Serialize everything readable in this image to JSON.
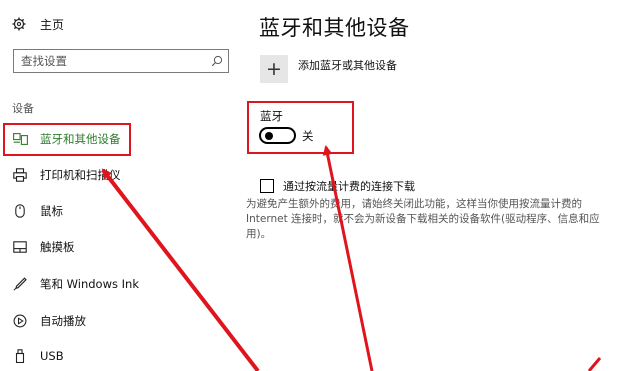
{
  "sidebar": {
    "home_label": "主页",
    "search_placeholder": "查找设置",
    "section_title": "设备",
    "items": [
      {
        "label": "蓝牙和其他设备",
        "icon": "bluetooth-devices-icon",
        "active": true
      },
      {
        "label": "打印机和扫描仪",
        "icon": "printer-icon",
        "active": false
      },
      {
        "label": "鼠标",
        "icon": "mouse-icon",
        "active": false
      },
      {
        "label": "触摸板",
        "icon": "touchpad-icon",
        "active": false
      },
      {
        "label": "笔和 Windows Ink",
        "icon": "pen-icon",
        "active": false
      },
      {
        "label": "自动播放",
        "icon": "autoplay-icon",
        "active": false
      },
      {
        "label": "USB",
        "icon": "usb-icon",
        "active": false
      }
    ]
  },
  "main": {
    "title": "蓝牙和其他设备",
    "add_device_label": "添加蓝牙或其他设备",
    "bluetooth_label": "蓝牙",
    "bluetooth_state": "关",
    "bluetooth_on": false,
    "metered_label": "通过按流量计费的连接下载",
    "metered_checked": false,
    "metered_description": "为避免产生额外的费用，请始终关闭此功能，这样当你使用按流量计费的 Internet 连接时，就不会为新设备下载相关的设备软件(驱动程序、信息和应用)。"
  },
  "colors": {
    "accent_active": "#2d7d2d",
    "highlight_red": "#e0141c"
  }
}
